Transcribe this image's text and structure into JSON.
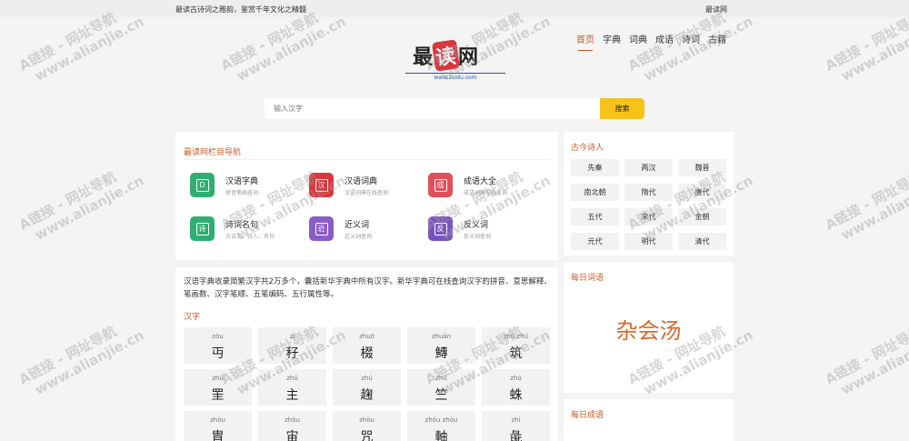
{
  "topbar": {
    "slogan": "最读古诗词之雅韵，鉴赏千年文化之精髓",
    "brand": "最读网"
  },
  "logo": {
    "text_pre": "最",
    "text_red": "读",
    "text_post": "网",
    "url": "www.zuidu.com"
  },
  "nav": {
    "items": [
      "首页",
      "字典",
      "词典",
      "成语",
      "诗词",
      "古籍"
    ],
    "active_index": 0
  },
  "search": {
    "placeholder": "输入汉字",
    "button": "搜索"
  },
  "column_nav": {
    "title": "最读网栏目导航",
    "items": [
      {
        "name": "汉语字典",
        "desc": "拼音笔画查词",
        "icon": "dictionary-icon",
        "icon_glyph": "D",
        "color": "#2fae72"
      },
      {
        "name": "汉语词典",
        "desc": "汉语词典在线查询",
        "icon": "han-seal-icon",
        "icon_glyph": "汉",
        "color": "#d9363e"
      },
      {
        "name": "成语大全",
        "desc": "成语词典在线查询",
        "icon": "idiom-book-icon",
        "icon_glyph": "成",
        "color": "#e0505a"
      },
      {
        "name": "诗词名句",
        "desc": "古诗文、诗人、名句",
        "icon": "poetry-icon",
        "icon_glyph": "诗",
        "color": "#2fae72"
      },
      {
        "name": "近义词",
        "desc": "近义词查询",
        "icon": "synonym-icon",
        "icon_glyph": "近",
        "color": "#8a5cc8"
      },
      {
        "name": "反义词",
        "desc": "反义词查询",
        "icon": "antonym-icon",
        "icon_glyph": "反",
        "color": "#7a52c0"
      }
    ]
  },
  "dict": {
    "intro": "汉语字典收录简繁汉字共2万多个，囊括新华字典中所有汉字。新华字典可在线查询汉字的拼音、意思解释、笔画数、汉字笔顺、五笔编码、五行属性等。",
    "hanzi_title": "汉字",
    "chars": [
      {
        "py": "zòu",
        "ch": "丏"
      },
      {
        "py": "zǐ",
        "ch": "秄"
      },
      {
        "py": "zhuō",
        "ch": "棳"
      },
      {
        "py": "zhuān",
        "ch": "鱄"
      },
      {
        "py": "zhù zhú",
        "ch": "筑"
      },
      {
        "py": "zhǔ",
        "ch": "罜"
      },
      {
        "py": "zhǔ",
        "ch": "主"
      },
      {
        "py": "zhú",
        "ch": "趜"
      },
      {
        "py": "zhú",
        "ch": "竺"
      },
      {
        "py": "zhū",
        "ch": "蛛"
      },
      {
        "py": "zhòu",
        "ch": "胄"
      },
      {
        "py": "zhòu",
        "ch": "宙"
      },
      {
        "py": "zhòu",
        "ch": "咒"
      },
      {
        "py": "zhóu zhòu",
        "ch": "軸"
      },
      {
        "py": "zhì",
        "ch": "彘"
      }
    ]
  },
  "poets": {
    "title": "古今诗人",
    "tags": [
      "先秦",
      "两汉",
      "魏晋",
      "南北朝",
      "隋代",
      "唐代",
      "五代",
      "宋代",
      "金朝",
      "元代",
      "明代",
      "清代"
    ]
  },
  "daily_word": {
    "title": "每日词语",
    "word": "杂会汤"
  },
  "daily_idiom": {
    "title": "每日成语"
  },
  "watermark": {
    "line1": "A链接 - 网址导航",
    "line2": "www.alianjie.cn"
  }
}
